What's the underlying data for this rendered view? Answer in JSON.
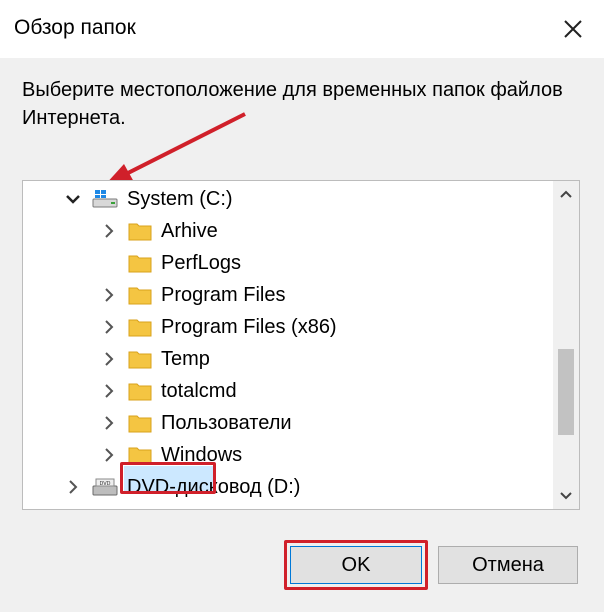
{
  "window": {
    "title": "Обзор папок",
    "close_icon": "close-icon"
  },
  "description": "Выберите местоположение для временных папок файлов Интернета.",
  "tree": {
    "items": [
      {
        "label": "System (C:)",
        "icon": "windows-drive-icon",
        "expander": "expanded",
        "selected": false
      },
      {
        "label": "Arhive",
        "icon": "folder-icon",
        "expander": "collapsed",
        "selected": false
      },
      {
        "label": "PerfLogs",
        "icon": "folder-icon",
        "expander": "none",
        "selected": false
      },
      {
        "label": "Program Files",
        "icon": "folder-icon",
        "expander": "collapsed",
        "selected": false
      },
      {
        "label": "Program Files (x86)",
        "icon": "folder-icon",
        "expander": "collapsed",
        "selected": false
      },
      {
        "label": "Temp",
        "icon": "folder-icon",
        "expander": "collapsed",
        "selected": true
      },
      {
        "label": "totalcmd",
        "icon": "folder-icon",
        "expander": "collapsed",
        "selected": false
      },
      {
        "label": "Пользователи",
        "icon": "folder-icon",
        "expander": "collapsed",
        "selected": false
      },
      {
        "label": "Windows",
        "icon": "folder-icon",
        "expander": "collapsed",
        "selected": false
      },
      {
        "label": "DVD-дисковод (D:)",
        "icon": "dvd-drive-icon",
        "expander": "collapsed",
        "selected": false
      }
    ]
  },
  "buttons": {
    "ok_label": "OK",
    "cancel_label": "Отмена"
  },
  "colors": {
    "annotation_red": "#d0202a",
    "folder_yellow": "#f4c542",
    "selection": "#cce8ff",
    "dialog_bg": "#f0f0f0"
  }
}
